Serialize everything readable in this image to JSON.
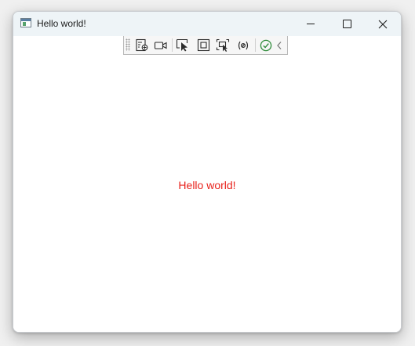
{
  "window": {
    "title": "Hello world!",
    "app_icon": "window-app-icon",
    "caption_buttons": [
      "minimize-icon",
      "maximize-icon",
      "close-icon"
    ]
  },
  "toolbar": {
    "tools": [
      "visual-tree-icon",
      "record-camera-icon",
      "select-element-icon",
      "display-layout-adorners-icon",
      "track-focused-element-icon",
      "binding-failures-icon",
      "accessibility-check-icon",
      "collapse-chevron-icon"
    ]
  },
  "content": {
    "text": "Hello world!",
    "text_color": "#e8221c"
  }
}
